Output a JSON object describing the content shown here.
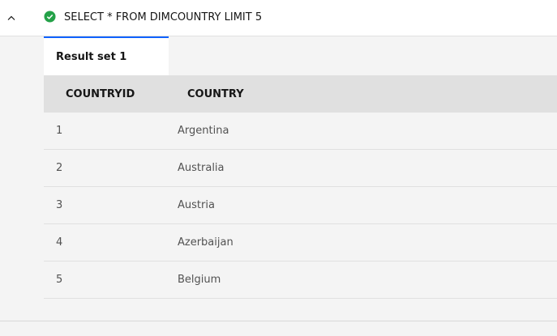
{
  "query": {
    "status": "success",
    "status_icon": "checkmark-filled-icon",
    "text": "SELECT * FROM DIMCOUNTRY LIMIT 5",
    "toggle_icon": "chevron-up-icon"
  },
  "tabs": [
    {
      "label": "Result set 1",
      "active": true
    }
  ],
  "table": {
    "columns": [
      "COUNTRYID",
      "COUNTRY"
    ],
    "rows": [
      [
        "1",
        "Argentina"
      ],
      [
        "2",
        "Australia"
      ],
      [
        "3",
        "Austria"
      ],
      [
        "4",
        "Azerbaijan"
      ],
      [
        "5",
        "Belgium"
      ]
    ]
  },
  "colors": {
    "accent": "#0f62fe",
    "success": "#24a148",
    "header_bg": "#e0e0e0"
  }
}
